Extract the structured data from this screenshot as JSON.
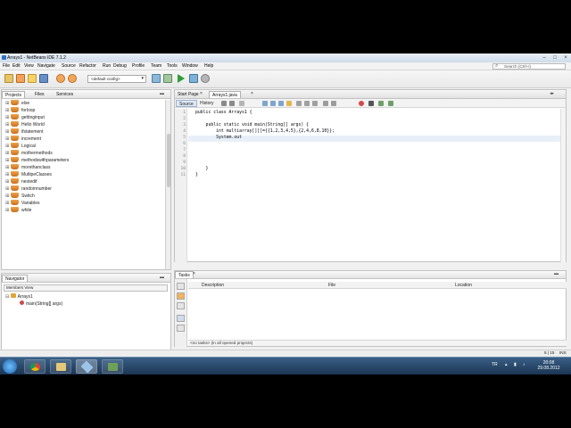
{
  "window": {
    "title": "Arrays1 - NetBeans IDE 7.1.2"
  },
  "menu": [
    "File",
    "Edit",
    "View",
    "Navigate",
    "Source",
    "Refactor",
    "Run",
    "Debug",
    "Profile",
    "Team",
    "Tools",
    "Window",
    "Help"
  ],
  "search": {
    "placeholder": "Search (Ctrl+I)"
  },
  "toolbar": {
    "config": "<default config>"
  },
  "projects_panel": {
    "tabs": [
      "Projects",
      "Files",
      "Services"
    ],
    "items": [
      "else",
      "forloop",
      "gettinginput",
      "Hello World",
      "ifstatement",
      "increment",
      "Logical",
      "mothermethods",
      "methodswithparameters",
      "morethanclass",
      "MultipeClasses",
      "nestedif",
      "randomnumber",
      "Switch",
      "Variables",
      "while"
    ]
  },
  "navigator": {
    "title": "Navigator",
    "members_label": "Members View",
    "class_name": "Arrays1",
    "method_name": "main(String[] args)"
  },
  "editor": {
    "tabs": [
      "Start Page",
      "Arrays1.java"
    ],
    "source_label": "Source",
    "history_label": "History",
    "lines": [
      "public class Arrays1 {",
      "",
      "    public static void main(String[] args) {",
      "        int multiarray[][]={{1,2,3,4,5},{2,4,6,8,10}};",
      "        System.out",
      "",
      "",
      "",
      "",
      "    }",
      "}"
    ],
    "line_numbers": [
      "1",
      "2",
      "3",
      "4",
      "5",
      "6",
      "7",
      "8",
      "9",
      "10",
      "11"
    ]
  },
  "tasks": {
    "title": "Tasks",
    "columns": [
      "Description",
      "File",
      "Location"
    ],
    "filter_text": "<no tasks> (in all opened projects)"
  },
  "statusbar": {
    "position": "5 | 15",
    "mode": "INS"
  },
  "taskbar": {
    "language": "TR",
    "time": "20:08",
    "date": "29.08.2012"
  },
  "colors": {
    "accent": "#2f72c3",
    "taskbar": "#1b3553",
    "editor_current_line": "#e9eff8"
  }
}
